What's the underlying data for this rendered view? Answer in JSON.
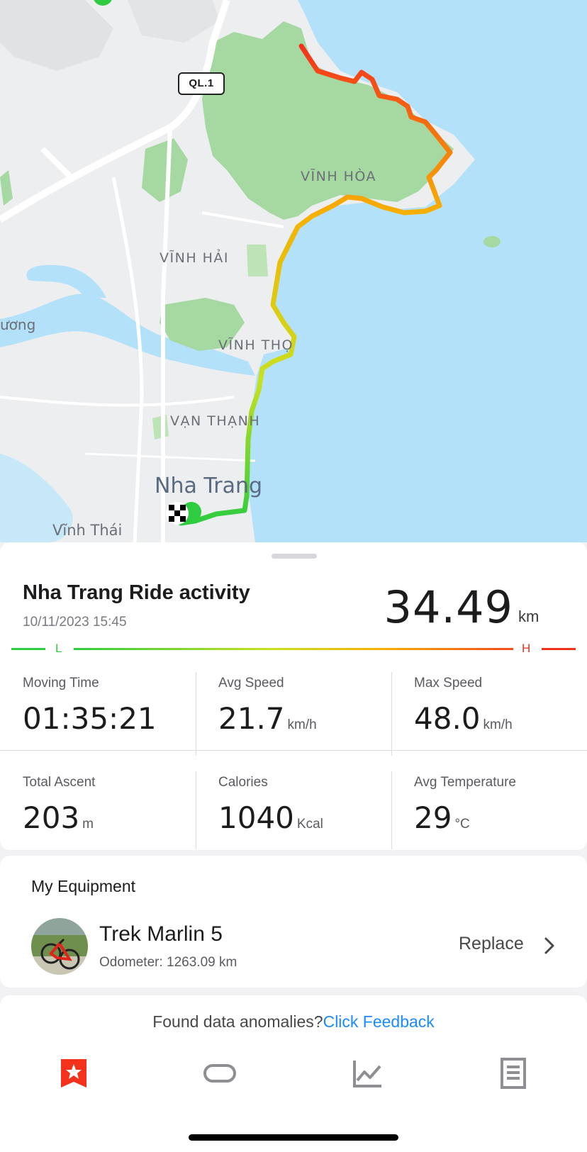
{
  "map": {
    "road_badge": "QL.1",
    "labels": [
      "VĨNH HÒA",
      "VĨNH HẢI",
      "VĨNH THỌ",
      "VẠN THẠNH",
      "ương",
      "Vĩnh Thái"
    ],
    "city": "Nha Trang",
    "colors": {
      "water": "#b4e1fa",
      "land": "#eceef0",
      "park": "#a6d8a2"
    }
  },
  "activity": {
    "title": "Nha Trang Ride activity",
    "datetime": "10/11/2023 15:45",
    "distance": "34.49",
    "distance_unit": "km",
    "legend_low": "L",
    "legend_high": "H"
  },
  "stats": {
    "moving_time": {
      "label": "Moving Time",
      "value": "01:35:21",
      "unit": ""
    },
    "avg_speed": {
      "label": "Avg Speed",
      "value": "21.7",
      "unit": "km/h"
    },
    "max_speed": {
      "label": "Max Speed",
      "value": "48.0",
      "unit": "km/h"
    },
    "total_ascent": {
      "label": "Total Ascent",
      "value": "203",
      "unit": "m"
    },
    "calories": {
      "label": "Calories",
      "value": "1040",
      "unit": "Kcal"
    },
    "avg_temperature": {
      "label": "Avg Temperature",
      "value": "29",
      "unit": "°C"
    }
  },
  "equipment": {
    "section_title": "My Equipment",
    "name": "Trek Marlin 5",
    "odometer": "Odometer: 1263.09 km",
    "replace_label": "Replace"
  },
  "feedback": {
    "question": "Found data anomalies?",
    "link": "Click Feedback"
  },
  "tabs": [
    {
      "icon": "star-bookmark-icon",
      "active": true,
      "color": "#f4321c"
    },
    {
      "icon": "band-device-icon",
      "active": false
    },
    {
      "icon": "chart-line-icon",
      "active": false
    },
    {
      "icon": "document-icon",
      "active": false
    }
  ]
}
